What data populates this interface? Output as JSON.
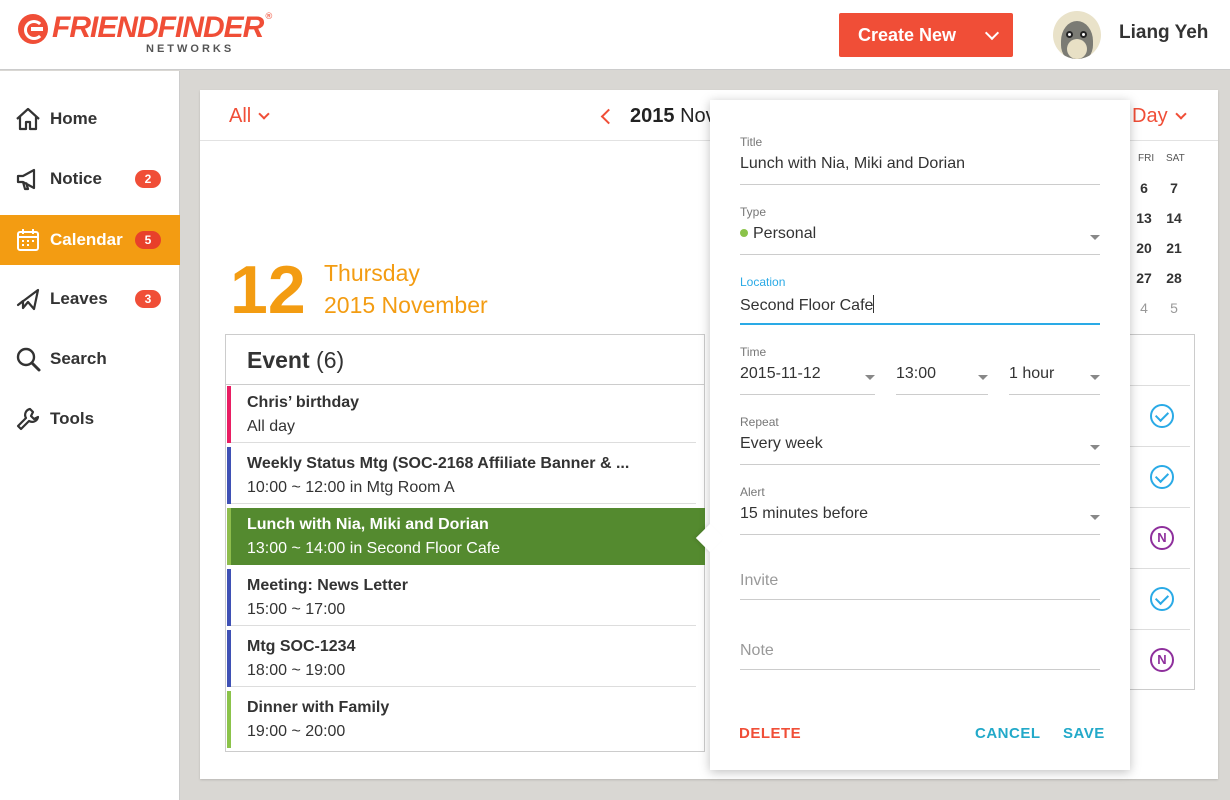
{
  "brand": {
    "name": "FRIENDFINDER",
    "sub": "NETWORKS",
    "reg": "®"
  },
  "header": {
    "create_label": "Create New",
    "username": "Liang Yeh"
  },
  "sidebar": {
    "items": [
      {
        "label": "Home",
        "icon": "home-icon",
        "badge": ""
      },
      {
        "label": "Notice",
        "icon": "megaphone-icon",
        "badge": "2"
      },
      {
        "label": "Calendar",
        "icon": "calendar-icon",
        "badge": "5"
      },
      {
        "label": "Leaves",
        "icon": "airplane-icon",
        "badge": "3"
      },
      {
        "label": "Search",
        "icon": "search-icon",
        "badge": ""
      },
      {
        "label": "Tools",
        "icon": "wrench-icon",
        "badge": ""
      }
    ]
  },
  "toolbar": {
    "filter": "All",
    "year": "2015",
    "month": "Nov",
    "view": "Day"
  },
  "day": {
    "number": "12",
    "weekday": "Thursday",
    "month_year": "2015 November"
  },
  "events": {
    "heading": "Event",
    "count": "(6)",
    "items": [
      {
        "title": "Chris’ birthday",
        "time": "All day",
        "color": "#e91e63"
      },
      {
        "title": "Weekly Status Mtg (SOC-2168 Affiliate Banner & ...",
        "time": "10:00 ~ 12:00 in Mtg Room A",
        "color": "#3f51b5"
      },
      {
        "title": "Lunch with Nia, Miki and Dorian",
        "time": "13:00 ~ 14:00 in Second Floor Cafe",
        "color": "#8bc34a"
      },
      {
        "title": "Meeting: News Letter",
        "time": "15:00 ~ 17:00",
        "color": "#3f51b5"
      },
      {
        "title": "Mtg SOC-1234",
        "time": "18:00 ~ 19:00",
        "color": "#3f51b5"
      },
      {
        "title": "Dinner with Family",
        "time": "19:00 ~ 20:00",
        "color": "#8bc34a"
      }
    ]
  },
  "mini_cal": {
    "heads": [
      "FRI",
      "SAT"
    ],
    "rows": [
      [
        "6",
        "7"
      ],
      [
        "13",
        "14"
      ],
      [
        "20",
        "21"
      ],
      [
        "27",
        "28"
      ],
      [
        "4",
        "5"
      ]
    ]
  },
  "dialog": {
    "title_label": "Title",
    "title_value": "Lunch with Nia, Miki and Dorian",
    "type_label": "Type",
    "type_value": "Personal",
    "location_label": "Location",
    "location_value": "Second Floor Cafe",
    "time_label": "Time",
    "date_value": "2015-11-12",
    "start_value": "13:00",
    "duration_value": "1 hour",
    "repeat_label": "Repeat",
    "repeat_value": "Every week",
    "alert_label": "Alert",
    "alert_value": "15 minutes before",
    "invite_placeholder": "Invite",
    "note_placeholder": "Note",
    "delete_label": "DELETE",
    "cancel_label": "CANCEL",
    "save_label": "SAVE"
  },
  "colors": {
    "accent": "#f04e37",
    "orange": "#f39c12",
    "active_event": "#548a2f",
    "blue": "#2aaae6",
    "purple": "#8e2f9c"
  }
}
